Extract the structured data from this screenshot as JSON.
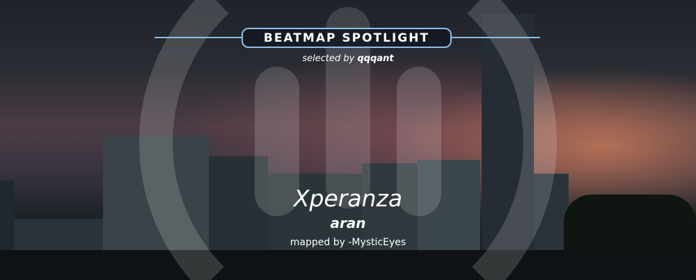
{
  "banner": {
    "heading": "BEATMAP SPOTLIGHT",
    "selected_prefix": "selected by",
    "selected_by": "qqqant",
    "accent_color": "#8ec0e8"
  },
  "beatmap": {
    "title": "Xperanza",
    "artist": "aran",
    "mapper_line": "mapped by -MysticEyes"
  },
  "logo_icon": "osu-logo-icon"
}
